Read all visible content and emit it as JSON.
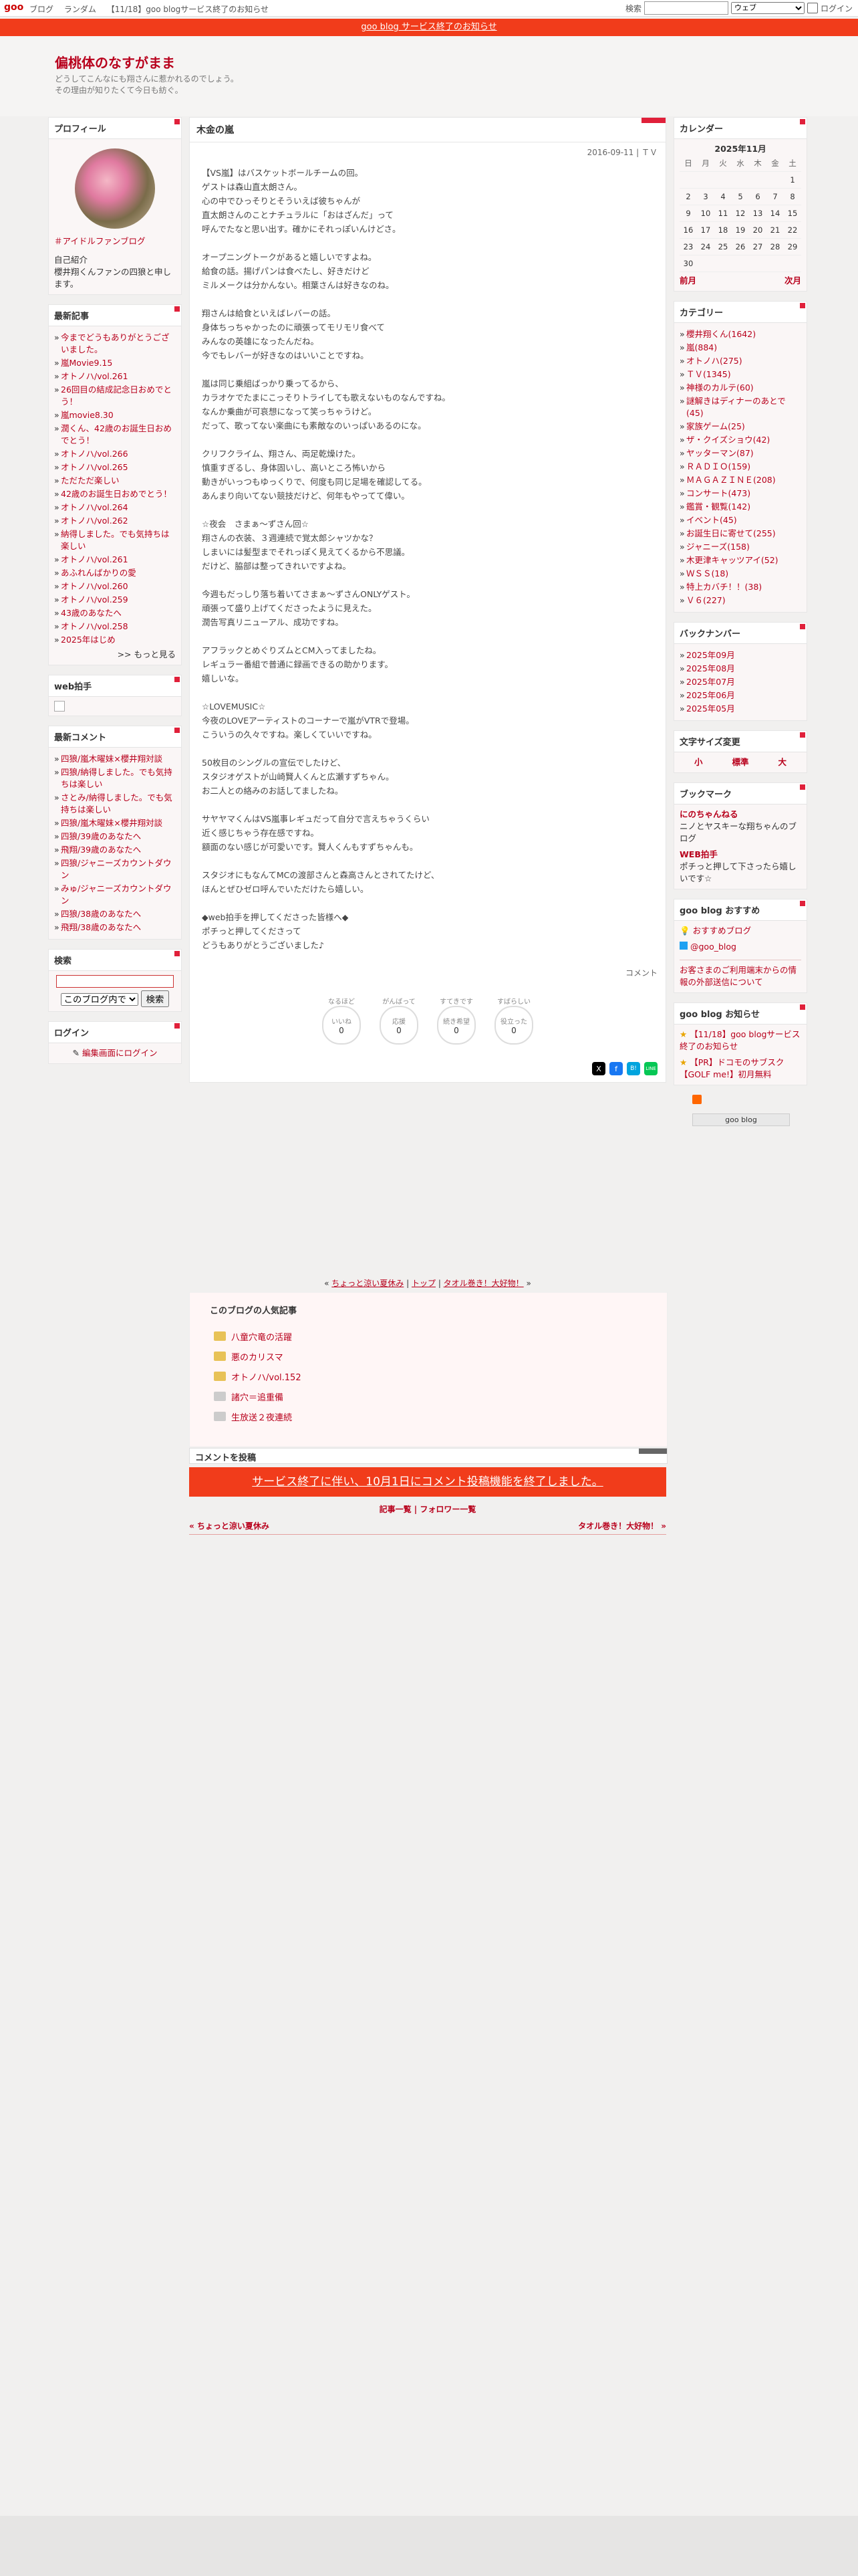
{
  "topbar": {
    "logo": "goo",
    "nav": [
      "ブログ",
      "ランダム",
      "【11/18】goo blogサービス終了のお知らせ"
    ],
    "search_label": "検索",
    "search_option": "ウェブ",
    "login": "ログイン"
  },
  "banner": "goo blog サービス終了のお知らせ",
  "blog": {
    "title": "偏桃体のなすがまま",
    "desc1": "どうしてこんなにも翔さんに惹かれるのでしょう。",
    "desc2": "その理由が知りたくて今日も紡ぐ。"
  },
  "profile": {
    "heading": "プロフィール",
    "link": "＃アイドルファンブログ",
    "intro_label": "自己紹介",
    "intro": "櫻井翔くんファンの四狼と申します。"
  },
  "recent": {
    "heading": "最新記事",
    "items": [
      "今までどうもありがとうございました。",
      "嵐Movie9.15",
      "オトノハ/vol.261",
      "26回目の結成記念日おめでとう！",
      "嵐movie8.30",
      "潤くん、42歳のお誕生日おめでとう！",
      "オトノハ/vol.266",
      "オトノハ/vol.265",
      "ただただ楽しい",
      "42歳のお誕生日おめでとう！",
      "オトノハ/vol.264",
      "オトノハ/vol.262",
      "納得しました。でも気持ちは楽しい",
      "オトノハ/vol.261",
      "あふれんばかりの愛",
      "オトノハ/vol.260",
      "オトノハ/vol.259",
      "43歳のあなたへ",
      "オトノハ/vol.258",
      "2025年はじめ"
    ],
    "more": ">> もっと見る"
  },
  "webclap": {
    "heading": "web拍手"
  },
  "recent_comments": {
    "heading": "最新コメント",
    "items": [
      "四狼/嵐木曜妹×櫻井翔対談",
      "四狼/納得しました。でも気持ちは楽しい",
      "さとみ/納得しました。でも気持ちは楽しい",
      "四狼/嵐木曜妹×櫻井翔対談",
      "四狼/39歳のあなたへ",
      "飛翔/39歳のあなたへ",
      "四狼/ジャニーズカウントダウン",
      "みゅ/ジャニーズカウントダウン",
      "四狼/38歳のあなたへ",
      "飛翔/38歳のあなたへ"
    ]
  },
  "searchbox": {
    "heading": "検索",
    "option": "このブログ内で",
    "button": "検索"
  },
  "login": {
    "heading": "ログイン",
    "link": "編集画面にログイン"
  },
  "article": {
    "title": "木金の嵐",
    "date": "2016-09-11 | ＴＶ",
    "body": "【VS嵐】はバスケットボールチームの回。\nゲストは森山直太朗さん。\n心の中でひっそりとそういえば彼ちゃんが\n直太朗さんのことナチュラルに「おはざんだ」って\n呼んでたなと思い出す。確かにそれっぽいんけどさ。\n\nオープニングトークがあると嬉しいですよね。\n給食の話。揚げパンは食べたし、好きだけど\nミルメークは分かんない。相葉さんは好きなのね。\n\n翔さんは給食といえばレバーの話。\n身体ちっちゃかったのに頑張ってモリモリ食べて\nみんなの英雄になったんだね。\n今でもレバーが好きなのはいいことですね。\n\n嵐は同じ乗組ばっかり乗ってるから、\nカラオケでたまにこっそりトライしても歌えないものなんですね。\nなんか乗曲が可哀想になって笑っちゃうけど。\nだって、歌ってない楽曲にも素敵なのいっぱいあるのにな。\n\nクリフクライム、翔さん、両足乾燥けた。\n慎重すぎるし、身体固いし、高いところ怖いから\n動きがいっつもゆっくりで、何度も同じ足場を確認してる。\nあんまり向いてない競技だけど、何年もやってて偉い。\n\n☆夜会　さまぁ～ずさん回☆\n翔さんの衣装、３週連続で覚太郎シャツかな？\nしまいには髪型までそれっぽく見えてくるから不思議。\nだけど、脇部は整ってきれいですよね。\n\n今週もだっしり落ち着いてさまぁ～ずさんONLYゲスト。\n頑張って盛り上げてくださったように見えた。\n潤告写真リニューアル、成功ですね。\n\nアフラックとめぐりズムとCM入ってましたね。\nレギュラー番組で普通に録画できるの助かります。\n嬉しいな。\n\n☆LOVEMUSIC☆\n今夜のLOVEアーティストのコーナーで嵐がVTRで登場。\nこういうの久々ですね。楽しくていいですね。\n\n50枚目のシングルの宣伝でしたけど、\nスタジオゲストが山崎賢人くんと広瀬すずちゃん。\nお二人との絡みのお話してましたね。\n\nサヤヤマくんはVS嵐事レギュだって自分で言えちゃうくらい\n近く感じちゃう存在感ですね。\n額面のない感じが可愛いです。賢人くんもすずちゃんも。\n\nスタジオにもなんてMCの渡部さんと森高さんとされてたけど、\nほんとぜひゼロ呼んでいただけたら嬉しい。\n\n◆web拍手を押してくださった皆様へ◆\nポチっと押してくださって\nどうもありがとうございました♪",
    "comment_link": "コメント"
  },
  "reactions": [
    {
      "top": "なるほど",
      "label": "いいね",
      "count": "0"
    },
    {
      "top": "がんばって",
      "label": "応援",
      "count": "0"
    },
    {
      "top": "すてきです",
      "label": "続き希望",
      "count": "0"
    },
    {
      "top": "すばらしい",
      "label": "役立った",
      "count": "0"
    }
  ],
  "share": [
    "X",
    "f",
    "B!",
    "LINE"
  ],
  "calendar": {
    "heading": "カレンダー",
    "month": "2025年11月",
    "weekdays": [
      "日",
      "月",
      "火",
      "水",
      "木",
      "金",
      "土"
    ],
    "weeks": [
      [
        "",
        "",
        "",
        "",
        "",
        "",
        "1"
      ],
      [
        "2",
        "3",
        "4",
        "5",
        "6",
        "7",
        "8"
      ],
      [
        "9",
        "10",
        "11",
        "12",
        "13",
        "14",
        "15"
      ],
      [
        "16",
        "17",
        "18",
        "19",
        "20",
        "21",
        "22"
      ],
      [
        "23",
        "24",
        "25",
        "26",
        "27",
        "28",
        "29"
      ],
      [
        "30",
        "",
        "",
        "",
        "",
        "",
        ""
      ]
    ],
    "prev": "前月",
    "next": "次月"
  },
  "category": {
    "heading": "カテゴリー",
    "items": [
      "櫻井翔くん(1642)",
      "嵐(884)",
      "オトノハ(275)",
      "ＴＶ(1345)",
      "神様のカルテ(60)",
      "謎解きはディナーのあとで(45)",
      "家族ゲーム(25)",
      "ザ・クイズショウ(42)",
      "ヤッターマン(87)",
      "ＲＡＤＩＯ(159)",
      "ＭＡＧＡＺＩＮＥ(208)",
      "コンサート(473)",
      "鑑賞・観覧(142)",
      "イベント(45)",
      "お誕生日に寄せて(255)",
      "ジャニーズ(158)",
      "木更津キャッツアイ(52)",
      "ＷＳＳ(18)",
      "特上カバチ！！(38)",
      "Ｖ６(227)"
    ]
  },
  "backnumber": {
    "heading": "バックナンバー",
    "items": [
      "2025年09月",
      "2025年08月",
      "2025年07月",
      "2025年06月",
      "2025年05月"
    ]
  },
  "fontsize": {
    "heading": "文字サイズ変更",
    "small": "小",
    "normal": "標準",
    "large": "大"
  },
  "bookmark": {
    "heading": "ブックマーク",
    "items": [
      {
        "name": "にのちゃんねる",
        "desc": "ニノとヤスキーな翔ちゃんのブログ"
      },
      {
        "name": "WEB拍手",
        "desc": "ポチっと押して下さったら嬉しいです☆"
      }
    ]
  },
  "recommend": {
    "heading": "goo blog おすすめ",
    "items": [
      "おすすめブログ",
      "@goo_blog"
    ],
    "notice": "お客さまのご利用端末からの情報の外部送信について"
  },
  "notice": {
    "heading": "goo blog お知らせ",
    "items": [
      "【11/18】goo blogサービス終了のお知らせ",
      "【PR】ドコモのサブスク【GOLF me!】初月無料"
    ]
  },
  "footer_logo": "goo blog",
  "pager": {
    "prev": "ちょっと涼い夏休み",
    "top": "トップ",
    "next": "タオル巻き！大好物！"
  },
  "popular": {
    "heading": "このブログの人気記事",
    "items": [
      "八童穴竜の活躍",
      "悪のカリスマ",
      "オトノハ/vol.152",
      "諸穴＝追重備",
      "生放送２夜連続"
    ]
  },
  "comment_post": {
    "heading": "コメントを投稿",
    "banner": "サービス終了に伴い、10月1日にコメント投稿機能を終了しました。"
  },
  "bottomnav": {
    "list": "記事一覧",
    "follow": "フォロワー一覧",
    "prev": "« ちょっと涼い夏休み",
    "next": "タオル巻き！大好物！ »"
  }
}
